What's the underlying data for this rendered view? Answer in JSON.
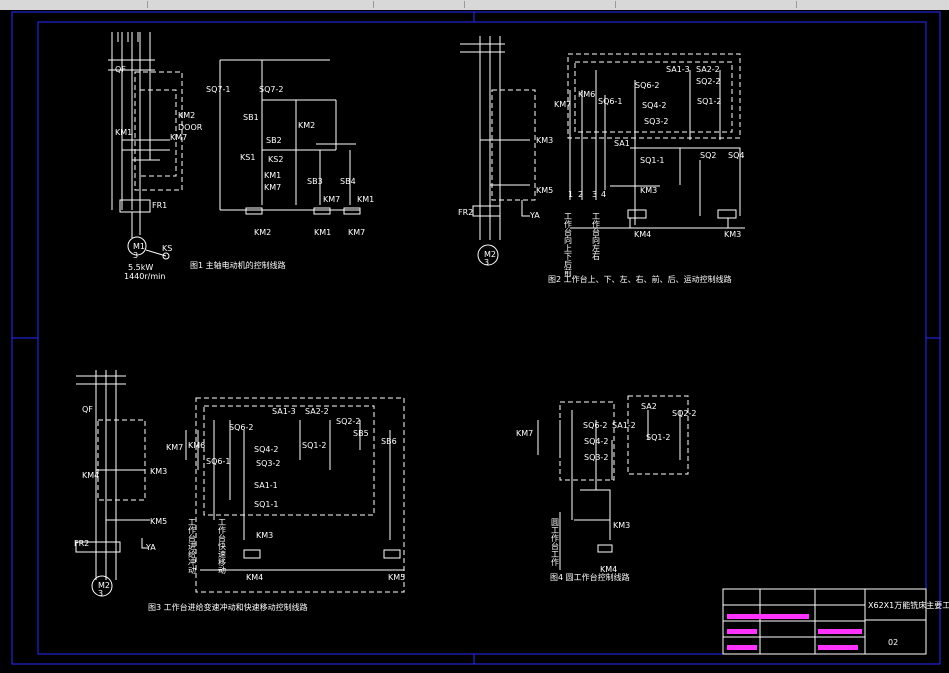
{
  "colors": {
    "background": "#000000",
    "line": "#ffffff",
    "frame": "#2a2aff",
    "titleblock_text": "#ff33ff"
  },
  "fig1": {
    "caption": "图1 主轴电动机的控制线路",
    "labels": {
      "qf": "QF",
      "km1": "KM1",
      "km2": "KM2",
      "km7": "KM7",
      "door": "DOOR",
      "fr1": "FR1",
      "motor": "M1",
      "motor_phase": "3",
      "speed_relay": "KS",
      "rating": "5.5kW",
      "rpm": "1440r/min",
      "sq7_1": "SQ7-1",
      "sq7_2": "SQ7-2",
      "sb1": "SB1",
      "sb2": "SB2",
      "ks1": "KS1",
      "ks2": "KS2",
      "ctl_km1": "KM1",
      "ctl_km7": "KM7",
      "ctl_km2": "KM2",
      "sb3": "SB3",
      "sb4": "SB4",
      "c_km7": "KM7",
      "c_km1": "KM1",
      "coil_km2": "KM2",
      "coil_km1": "KM1",
      "coil_km7": "KM7"
    }
  },
  "fig2": {
    "caption": "图2 工作台上、下、左、右、前、后、运动控制线路",
    "labels": {
      "km7": "KM7",
      "km6": "KM6",
      "km3": "KM3",
      "km5": "KM5",
      "fr2": "FR2",
      "ya": "YA",
      "motor": "M2",
      "motor_phase": "3",
      "sa1_3": "SA1-3",
      "sa2_2": "SA2-2",
      "sq6_2": "SQ6-2",
      "sq2_2": "SQ2-2",
      "sq4_2": "SQ4-2",
      "sq1_2": "SQ1-2",
      "sq3_2": "SQ3-2",
      "sa1": "SA1",
      "sq1_1": "SQ1-1",
      "sq2": "SQ2",
      "sq4": "SQ4",
      "sq6_1": "SQ6-1",
      "sq1": "SQ1",
      "sq3": "SQ3",
      "ctl_km3": "KM3",
      "ctl_km4": "KM4",
      "ctl_km3b": "KM3",
      "n1": "1",
      "n2": "2",
      "n3": "3",
      "n4": "4",
      "col1": "工作台向上下后前",
      "col2": "工作台向左右"
    }
  },
  "fig3": {
    "caption": "图3 工作台进给变速冲动和快速移动控制线路",
    "labels": {
      "qf": "QF",
      "km4": "KM4",
      "km3": "KM3",
      "km5": "KM5",
      "fr2": "FR2",
      "ya": "YA",
      "motor": "M2",
      "motor_phase": "3",
      "km7": "KM7",
      "km6": "KM6",
      "sq6_2": "SQ6-2",
      "sq6_1": "SQ6-1",
      "sa1_3": "SA1-3",
      "sa2_2": "SA2-2",
      "sq4_2": "SQ4-2",
      "sq3_2": "SQ3-2",
      "sq2_2": "SQ2-2",
      "sq1_2": "SQ1-2",
      "sb5": "SB5",
      "sb6": "SB6",
      "sa1_1": "SA1-1",
      "sq1_1": "SQ1-1",
      "ctl_km3": "KM3",
      "coil_km4": "KM4",
      "coil_km5": "KM5",
      "col1": "工作台进给冲动",
      "col2": "工作台快速移动"
    }
  },
  "fig4": {
    "caption": "图4 圆工作台控制线路",
    "labels": {
      "km7": "KM7",
      "sq6_2": "SQ6-2",
      "sa1_2": "SA1-2",
      "sq4_2": "SQ4-2",
      "sq3_2": "SQ3-2",
      "sa2": "SA2",
      "sq2_2": "SQ2-2",
      "sq1_2": "SQ1-2",
      "km3": "KM3",
      "km4": "KM4",
      "col": "圆工作台工作"
    }
  },
  "titleblock": {
    "title": "X62X1万能铣床主要工作线路",
    "sheet": "02",
    "row1": "标记 处数 分区 更改文件号 签名 年月日",
    "row2": "设计",
    "row3": "审核",
    "row4": "工艺",
    "scale_labels": "阶段标记 重量 比例",
    "sheet_info": "共 张 第 张"
  }
}
